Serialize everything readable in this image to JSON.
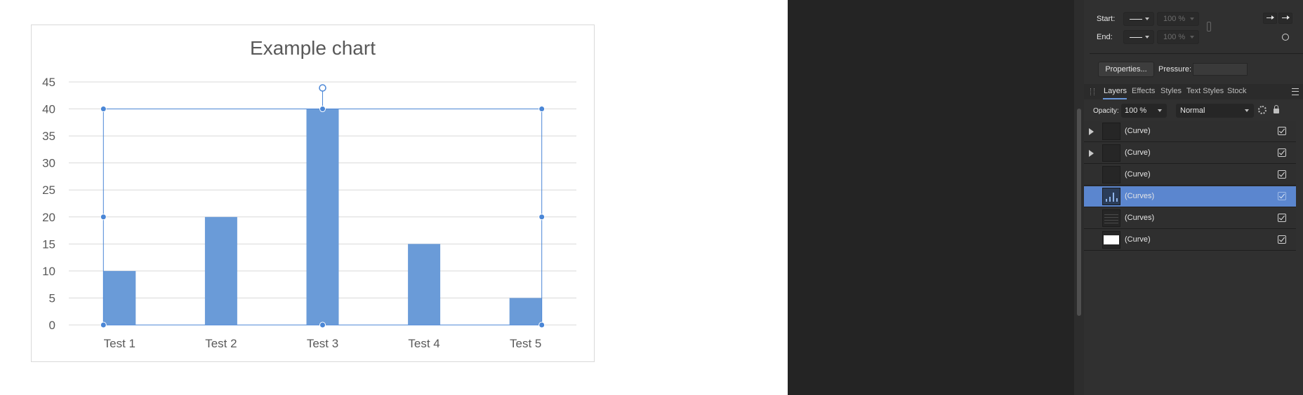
{
  "chart_data": {
    "type": "bar",
    "title": "Example chart",
    "categories": [
      "Test 1",
      "Test 2",
      "Test 3",
      "Test 4",
      "Test 5"
    ],
    "values": [
      10,
      20,
      40,
      15,
      5
    ],
    "yticks": [
      "0",
      "5",
      "10",
      "15",
      "20",
      "25",
      "30",
      "35",
      "40",
      "45"
    ],
    "ylim": [
      0,
      45
    ],
    "xlabel": "",
    "ylabel": "",
    "grid": true,
    "bar_color": "#6a9bd8"
  },
  "panel": {
    "start_label": "Start:",
    "end_label": "End:",
    "start_percent": "100 %",
    "end_percent": "100 %",
    "properties_button": "Properties...",
    "pressure_label": "Pressure:",
    "tabs": [
      "Layers",
      "Effects",
      "Styles",
      "Text Styles",
      "Stock"
    ],
    "opacity_label": "Opacity:",
    "opacity_value": "100 %",
    "blend_mode": "Normal",
    "layers": [
      {
        "name": "(Curve)",
        "expandable": true,
        "selected": false,
        "visible": true,
        "thumb": "dark"
      },
      {
        "name": "(Curve)",
        "expandable": true,
        "selected": false,
        "visible": true,
        "thumb": "dark"
      },
      {
        "name": "(Curve)",
        "expandable": false,
        "selected": false,
        "visible": true,
        "thumb": "dark"
      },
      {
        "name": "(Curves)",
        "expandable": false,
        "selected": true,
        "visible": true,
        "thumb": "bars"
      },
      {
        "name": "(Curves)",
        "expandable": false,
        "selected": false,
        "visible": true,
        "thumb": "lines"
      },
      {
        "name": "(Curve)",
        "expandable": false,
        "selected": false,
        "visible": true,
        "thumb": "white"
      }
    ]
  },
  "colors": {
    "accent": "#5b86cf",
    "selection": "#4a86d6",
    "panel_bg": "#303030",
    "dark_bg": "#242424"
  }
}
